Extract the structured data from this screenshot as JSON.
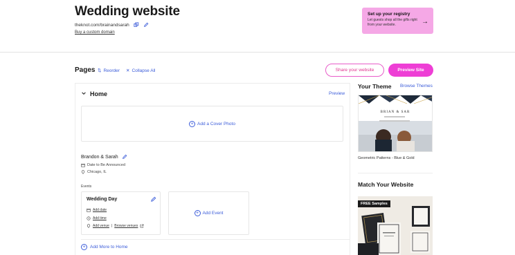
{
  "header": {
    "title": "Wedding website",
    "url": "theknot.com/brainandsarah",
    "custom_domain": "Buy a custom domain"
  },
  "registry": {
    "title": "Set up your registry",
    "subtitle": "Let guests shop all the gifts right from your website.",
    "arrow": "→"
  },
  "pages_bar": {
    "label": "Pages",
    "reorder": "Reorder",
    "collapse": "Collapse All",
    "share_button": "Share your website",
    "preview_button": "Preview Site"
  },
  "home": {
    "title": "Home",
    "preview": "Preview",
    "add_cover": "Add a Cover Photo",
    "couple": "Brandon & Sarah",
    "date": "Date to Be Announced",
    "location": "Chicago, IL",
    "events_label": "Events",
    "event": {
      "title": "Wedding Day",
      "add_date": "Add date",
      "add_time": "Add time",
      "add_venue": "Add venue",
      "browse_venues": "Browse venues"
    },
    "add_event": "Add Event",
    "add_more": "Add More to Home"
  },
  "sidebar": {
    "theme_title": "Your Theme",
    "browse_themes": "Browse Themes",
    "theme_preview_names": "BRIAN & SAR",
    "theme_caption": "Geometric Patterns - Blue & Gold",
    "match_title": "Match Your Website",
    "samples_badge": "FREE Samples"
  },
  "colors": {
    "accent_pink": "#ee3ed5",
    "registry_bg": "#f5a8e6",
    "link_blue": "#3a5bd9"
  }
}
